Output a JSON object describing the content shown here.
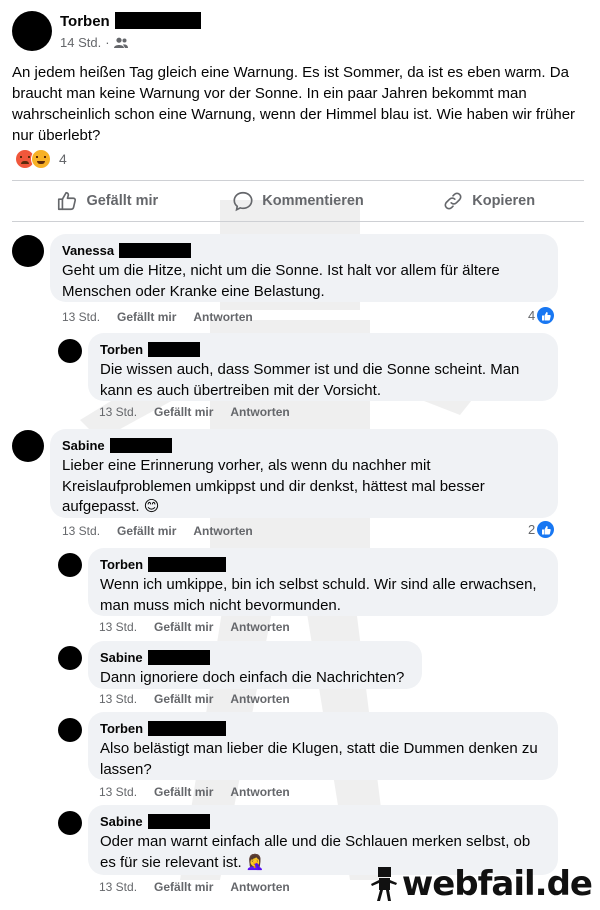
{
  "post": {
    "author": "Torben",
    "time": "14 Std.",
    "separator": "·",
    "audience_icon": "friends-icon",
    "text": "An jedem heißen Tag gleich eine Warnung. Es ist Sommer, da ist es eben warm. Da braucht man keine Warnung vor der Sonne. In ein paar Jahren bekommt man wahrscheinlich schon eine Warnung, wenn der Himmel blau ist. Wie haben wir früher nur überlebt?",
    "reaction_icons": [
      "angry-emoji-icon",
      "laughing-emoji-icon"
    ],
    "reaction_count": "4"
  },
  "actions": {
    "like": "Gefällt mir",
    "comment": "Kommentieren",
    "copy": "Kopieren"
  },
  "comment_meta": {
    "like": "Gefällt mir",
    "reply": "Antworten"
  },
  "comments": [
    {
      "author": "Vanessa",
      "text": "Geht um die Hitze, nicht um die Sonne. Ist halt vor allem für ältere Menschen oder Kranke eine Belastung.",
      "time": "13 Std.",
      "likes": "4"
    },
    {
      "author": "Torben",
      "text": "Die wissen auch, dass Sommer ist und die Sonne scheint. Man kann es auch übertreiben mit der Vorsicht.",
      "time": "13 Std."
    },
    {
      "author": "Sabine",
      "text": "Lieber eine Erinnerung vorher, als wenn du nachher mit Kreislaufproblemen umkippst und dir denkst, hättest mal besser aufgepasst. 😊",
      "time": "13 Std.",
      "likes": "2"
    },
    {
      "author": "Torben",
      "text": "Wenn ich umkippe, bin ich selbst schuld. Wir sind alle erwachsen, man muss mich nicht bevormunden.",
      "time": "13 Std."
    },
    {
      "author": "Sabine",
      "text": "Dann ignoriere doch einfach die Nachrichten?",
      "time": "13 Std."
    },
    {
      "author": "Torben",
      "text": "Also belästigt man lieber die Klugen, statt die Dummen denken zu lassen?",
      "time": "13 Std."
    },
    {
      "author": "Sabine",
      "text": "Oder man warnt einfach alle und die Schlauen merken selbst, ob es für sie relevant ist. 🤦‍♀️",
      "time": "13 Std."
    }
  ],
  "watermark": {
    "logo_text": "webfail.de"
  }
}
